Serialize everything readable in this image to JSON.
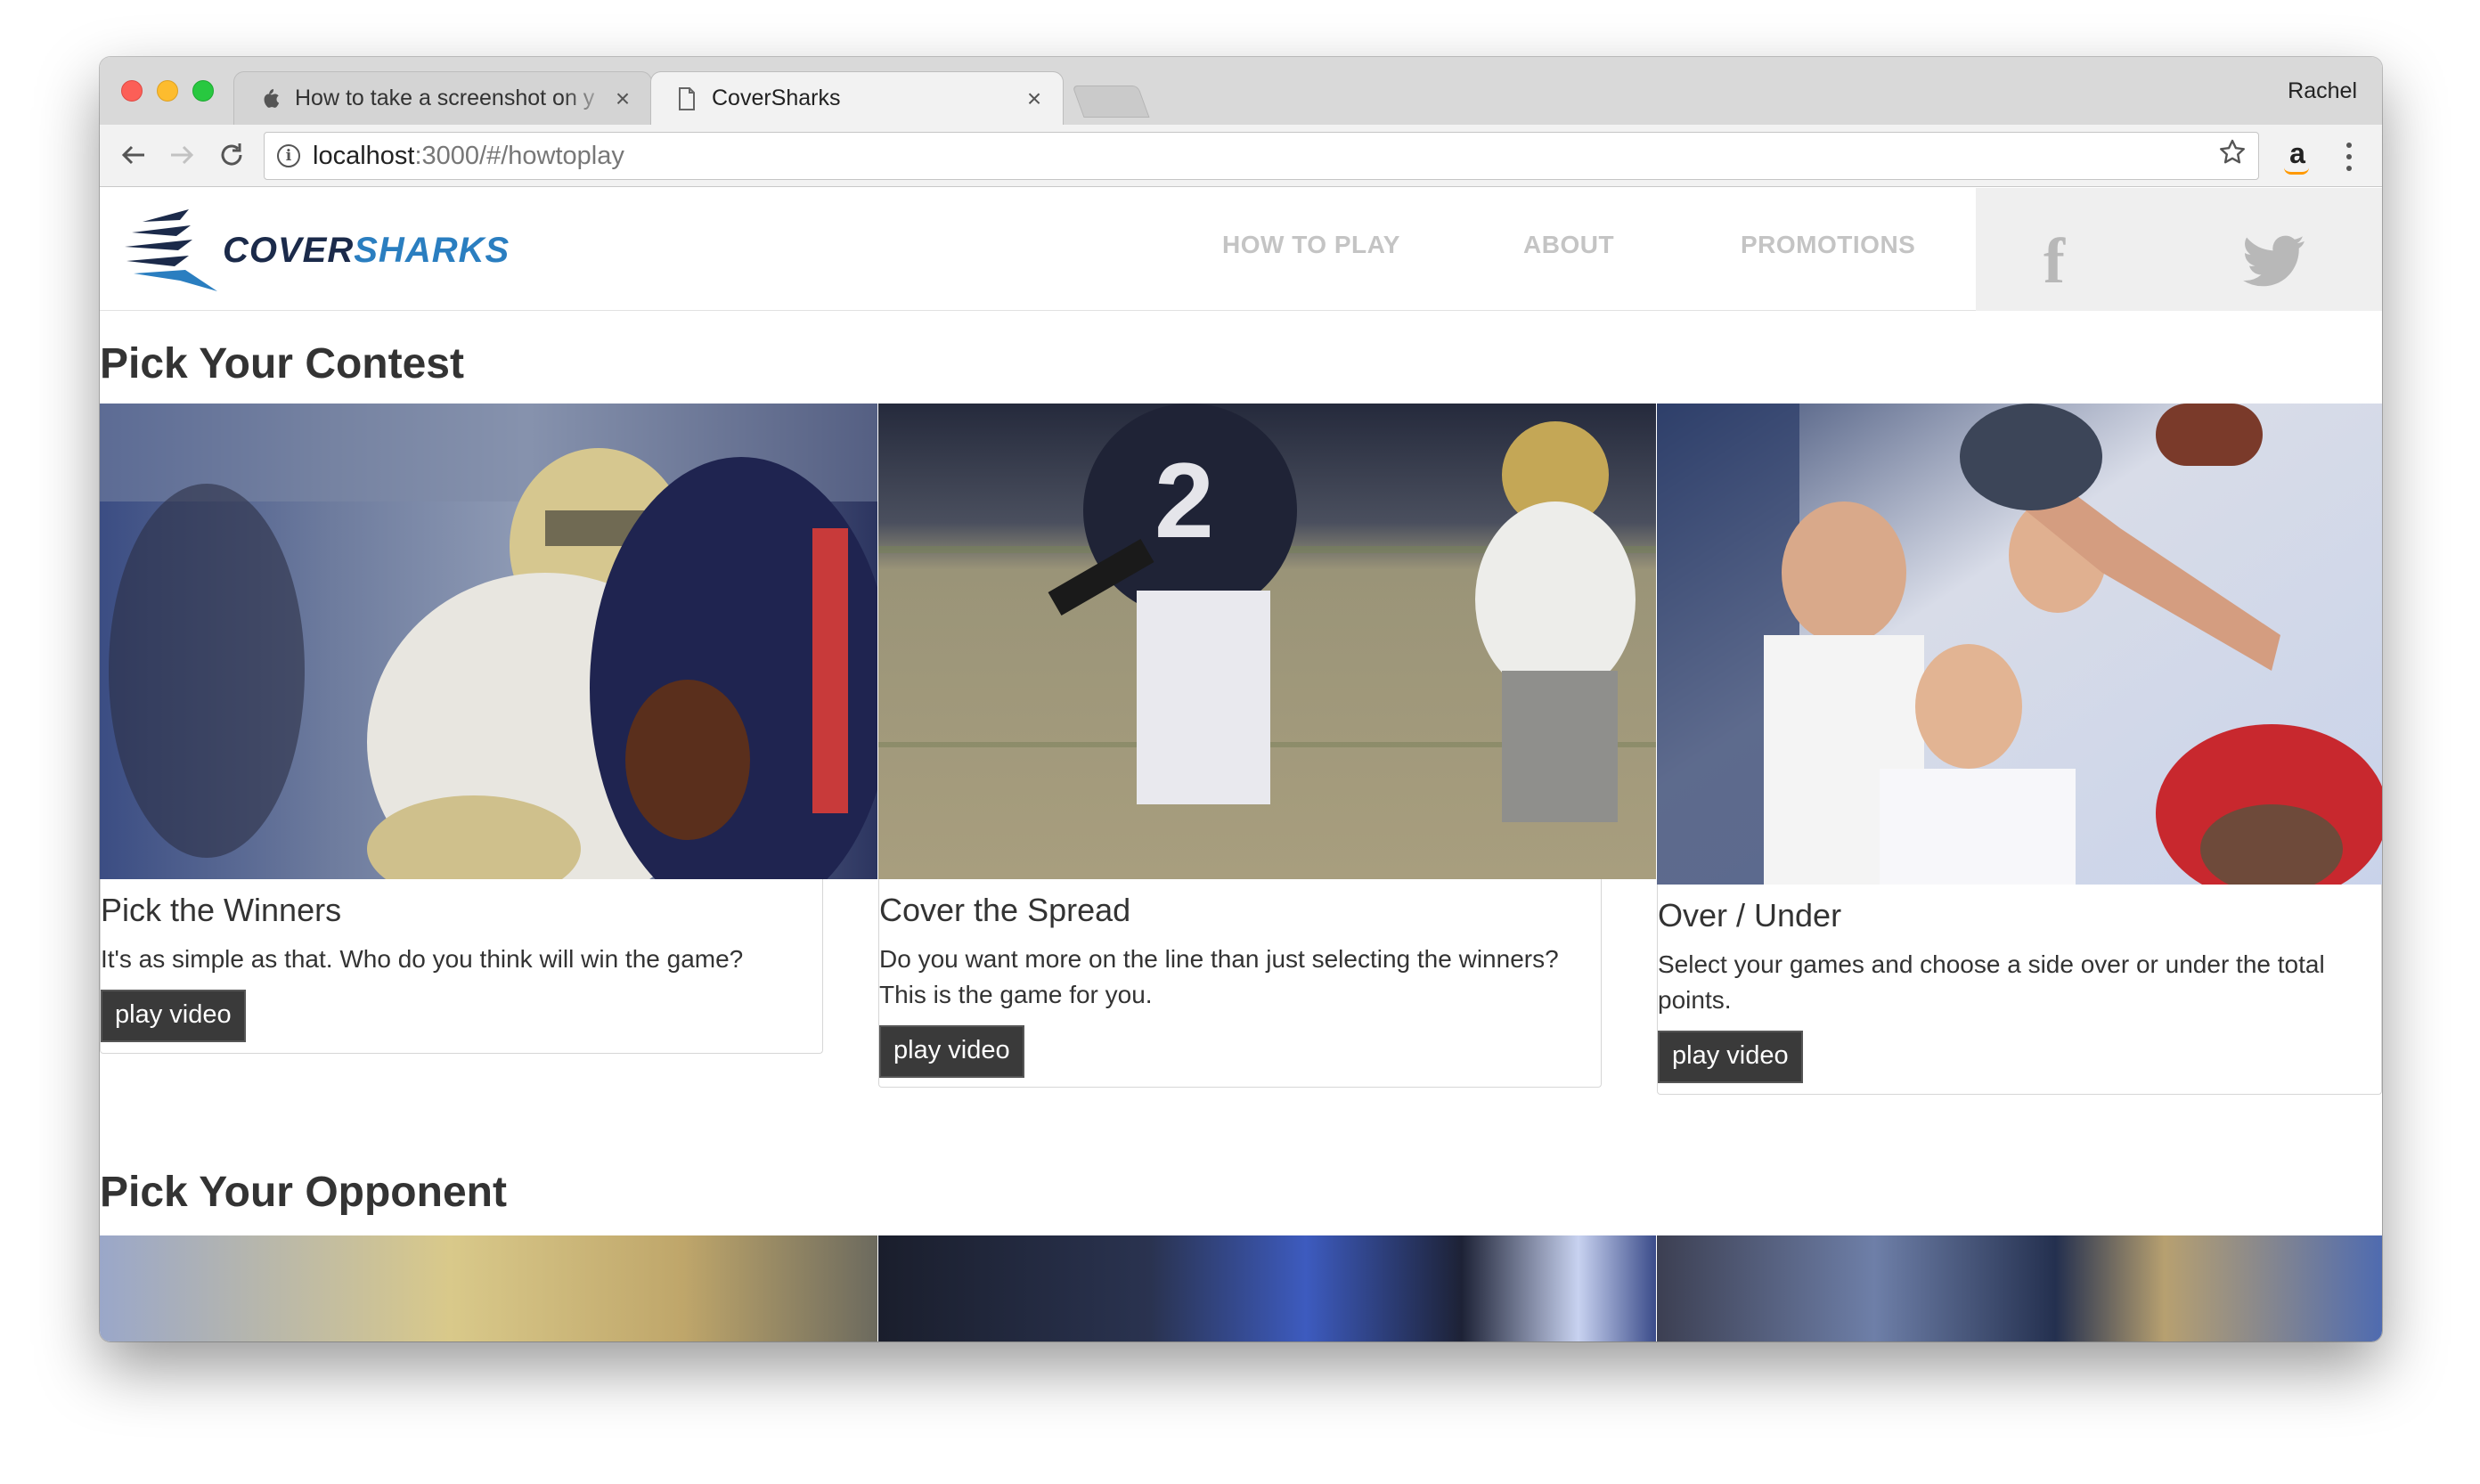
{
  "browser": {
    "tabs": [
      {
        "title": "How to take a screenshot on y",
        "icon": "apple-icon",
        "close": "×"
      },
      {
        "title": "CoverSharks",
        "icon": "document-icon",
        "close": "×"
      }
    ],
    "profile_name": "Rachel",
    "url_host": "localhost",
    "url_path": ":3000/#/howtoplay",
    "info_glyph": "i",
    "amazon_glyph": "a"
  },
  "site": {
    "logo_part1": "COVER",
    "logo_part2": "SHARKS",
    "nav": {
      "how_to_play": "HOW TO PLAY",
      "about": "ABOUT",
      "promotions": "PROMOTIONS"
    },
    "social": {
      "facebook_glyph": "f"
    }
  },
  "sections": {
    "contest_title": "Pick Your Contest",
    "opponent_title": "Pick Your Opponent"
  },
  "cards": [
    {
      "title": "Pick the Winners",
      "text": "It's as simple as that. Who do you think will win the game?",
      "button": "play video"
    },
    {
      "title": "Cover the Spread",
      "text": "Do you want more on the line than just selecting the winners? This is the game for you.",
      "button": "play video"
    },
    {
      "title": "Over / Under",
      "text": "Select your games and choose a side over or under the total points.",
      "button": "play video"
    }
  ],
  "colors": {
    "logo_dark": "#1b2a4a",
    "logo_accent": "#2a7ec0",
    "nav_text": "#c4c4c4",
    "button_bg": "#3a3a3a"
  }
}
